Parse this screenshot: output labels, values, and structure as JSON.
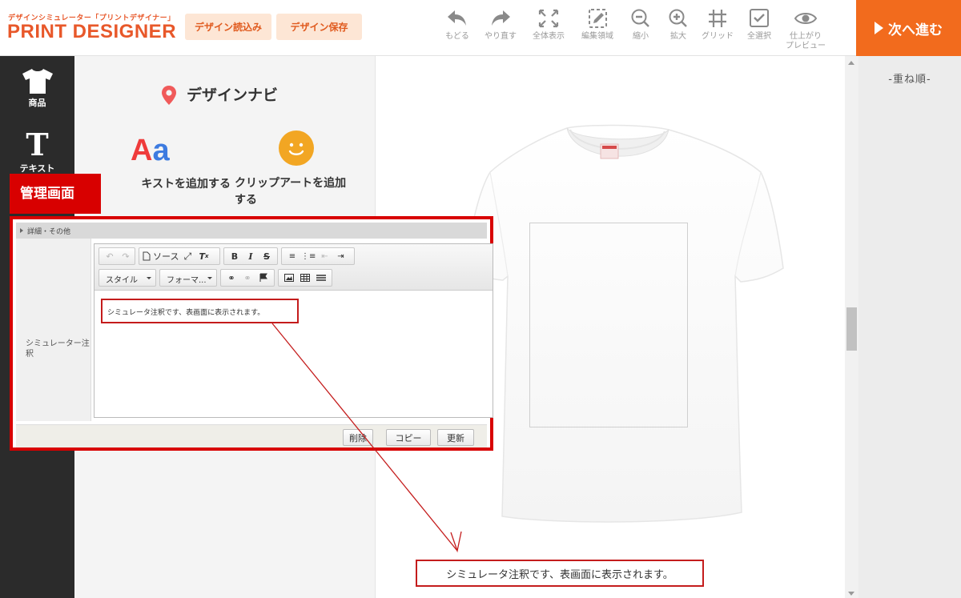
{
  "header": {
    "logo_sub": "デザインシミュレーター「プリントデザイナー」",
    "logo_main": "PRINT DESIGNER",
    "load_button": "デザイン読込み",
    "save_button": "デザイン保存",
    "tools": {
      "undo": "もどる",
      "redo": "やり直す",
      "fit": "全体表示",
      "edit_area": "編集領域",
      "zoom_out": "縮小",
      "zoom_in": "拡大",
      "grid": "グリッド",
      "select_all": "全選択",
      "preview_line1": "仕上がり",
      "preview_line2": "プレビュー"
    },
    "next_button": "次へ進む",
    "next_color": "#f26b1d"
  },
  "sidebar": {
    "items": [
      {
        "label": "商品",
        "icon": "tshirt-icon"
      },
      {
        "label": "テキスト",
        "icon": "text-icon"
      }
    ]
  },
  "navi": {
    "title": "デザインナビ",
    "add_text": "キストを追加する",
    "add_clipart_line1": "クリップアートを追加",
    "add_clipart_line2": "する",
    "aa_a1": "A",
    "aa_a2": "a"
  },
  "layer_panel": {
    "title": "-重ね順-"
  },
  "admin": {
    "label": "管理画面",
    "section_header": "詳細・その他",
    "field_label": "シミュレーター注釈",
    "toolbar": {
      "source": "ソース",
      "bold": "B",
      "italic": "I",
      "strike": "S",
      "style_select": "スタイル",
      "format_select": "フォーマ..."
    },
    "editor_content": "シミュレータ注釈です、表画面に表示されます。",
    "buttons": {
      "delete": "削除",
      "copy": "コピー",
      "update": "更新"
    },
    "highlight_color": "#d80000"
  },
  "canvas": {
    "bottom_note": "シミュレータ注釈です、表画面に表示されます。"
  }
}
